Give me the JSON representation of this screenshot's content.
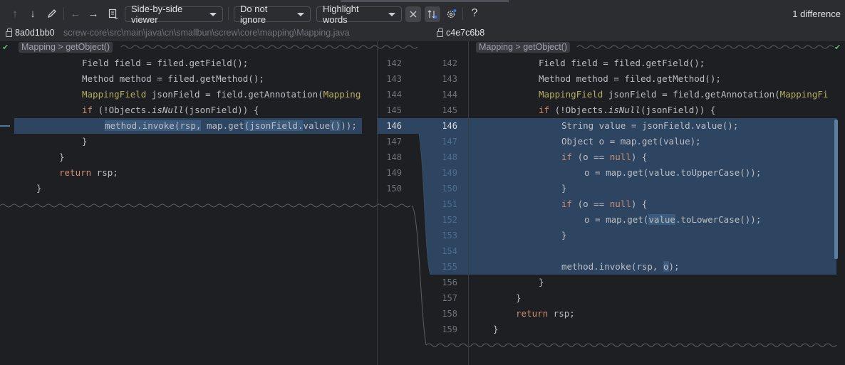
{
  "toolbar": {
    "viewer_label": "Side-by-side viewer",
    "ignore_label": "Do not ignore",
    "highlight_label": "Highlight words",
    "help_icon": "?",
    "difference_count": "1 difference"
  },
  "infobar": {
    "left_hash": "8a0d1bb0",
    "left_path": "screw-core\\src\\main\\java\\cn\\smallbun\\screw\\core\\mapping\\Mapping.java",
    "right_hash": "c4e7c6b8"
  },
  "breadcrumb": {
    "text": "Mapping > getObject()"
  },
  "left_lines": [
    "Field field = filed.getField();",
    "Method method = filed.getMethod();",
    "MappingField jsonField = field.getAnnotation(Mapping",
    "if (!Objects.isNull(jsonField)) {",
    "method.invoke(rsp, map.get(jsonField.value()));",
    "}",
    "}",
    "return rsp;",
    "}"
  ],
  "left_numbers": [
    "142",
    "143",
    "144",
    "145",
    "146",
    "147",
    "148",
    "149",
    "150"
  ],
  "right_numbers": [
    "142",
    "143",
    "144",
    "145",
    "146",
    "147",
    "148",
    "149",
    "150",
    "151",
    "152",
    "153",
    "154",
    "155",
    "156",
    "157",
    "158",
    "159"
  ],
  "right_lines": [
    "Field field = filed.getField();",
    "Method method = filed.getMethod();",
    "MappingField jsonField = field.getAnnotation(MappingFi",
    "if (!Objects.isNull(jsonField)) {",
    "String value = jsonField.value();",
    "Object o = map.get(value);",
    "if (o == null) {",
    "o = map.get(value.toUpperCase());",
    "}",
    "if (o == null) {",
    "o = map.get(value.toLowerCase());",
    "}",
    "",
    "method.invoke(rsp, o);",
    "}",
    "}",
    "return rsp;",
    "}"
  ],
  "colors": {
    "background": "#1e1f22",
    "toolbar": "#2b2d30",
    "changed_block": "#2d4560",
    "word_highlight": "#3c5a7b",
    "keyword": "#cf8e6d",
    "annotation": "#b3ae60",
    "line_number": "#6f737a"
  },
  "icons": [
    "arrow-up-icon",
    "arrow-down-icon",
    "pencil-icon",
    "arrow-left-icon",
    "arrow-right-icon",
    "document-icon",
    "collapse-icon",
    "sync-scroll-icon",
    "gear-icon",
    "help-icon",
    "lock-icon",
    "checkmark-icon"
  ]
}
